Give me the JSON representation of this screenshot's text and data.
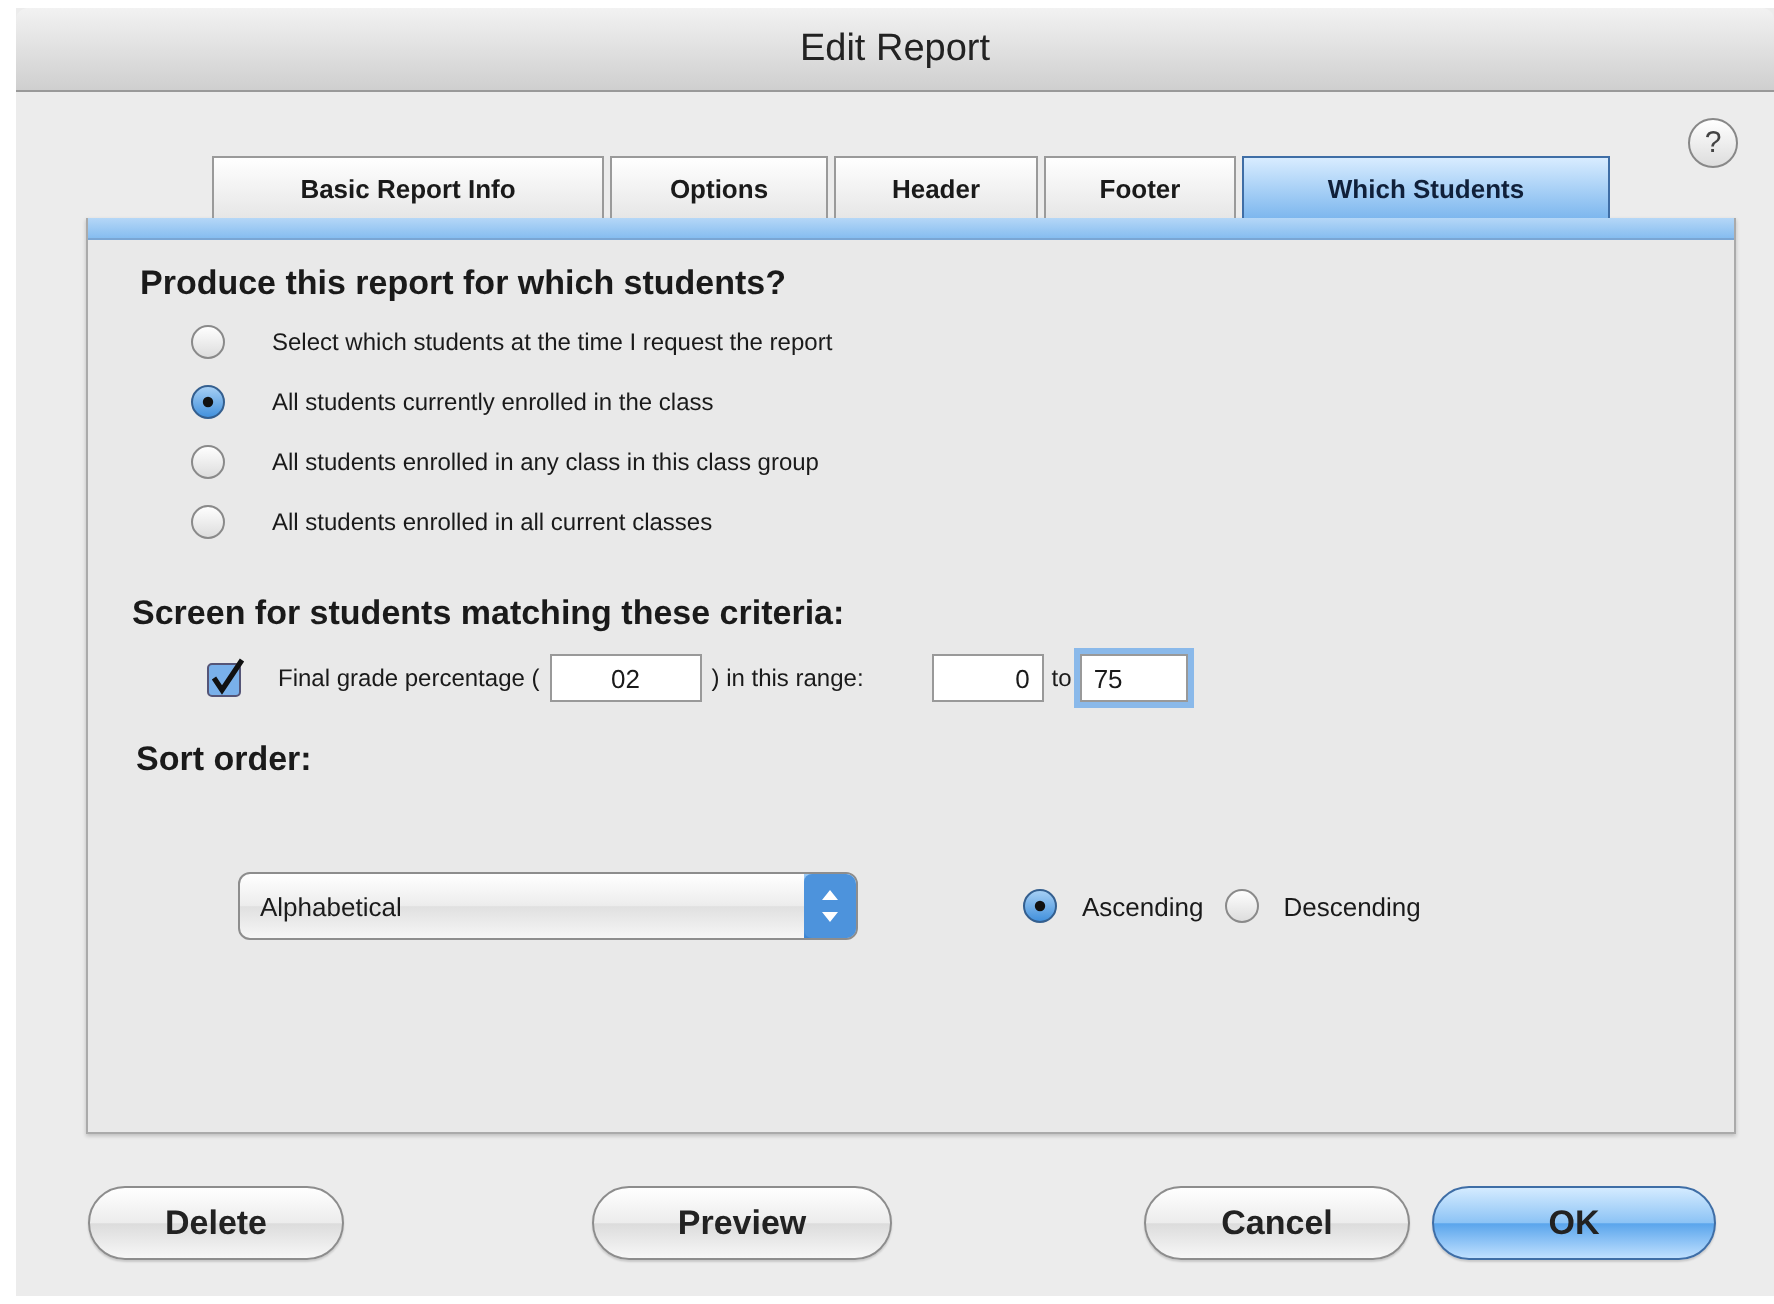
{
  "window": {
    "title": "Edit Report"
  },
  "help_button": {
    "label": "?"
  },
  "tabs": [
    {
      "label": "Basic Report Info",
      "selected": false
    },
    {
      "label": "Options",
      "selected": false
    },
    {
      "label": "Header",
      "selected": false
    },
    {
      "label": "Footer",
      "selected": false
    },
    {
      "label": "Which Students",
      "selected": true
    }
  ],
  "recipients": {
    "heading": "Produce this report for which students?",
    "options": [
      {
        "label": "Select which students at the time I request the report",
        "selected": false
      },
      {
        "label": "All students currently enrolled in the class",
        "selected": true
      },
      {
        "label": "All students enrolled in any class in this class group",
        "selected": false
      },
      {
        "label": "All students enrolled in all current classes",
        "selected": false
      }
    ]
  },
  "criteria": {
    "heading": "Screen for students matching these criteria:",
    "filter": {
      "checked": true,
      "label": "Final grade percentage (",
      "field": {
        "value": "02"
      },
      "range_label": ") in this range:",
      "min": {
        "value": "0"
      },
      "to": "to",
      "max": {
        "value": "75",
        "focused": true
      }
    }
  },
  "sort": {
    "heading": "Sort order:",
    "field": {
      "value": "Alphabetical"
    },
    "directions": [
      {
        "label": "Ascending",
        "selected": true
      },
      {
        "label": "Descending",
        "selected": false
      }
    ]
  },
  "buttons": [
    {
      "label": "Delete",
      "kind": "normal"
    },
    {
      "label": "Preview",
      "kind": "normal"
    },
    {
      "label": "Cancel",
      "kind": "normal"
    },
    {
      "label": "OK",
      "kind": "default"
    }
  ]
}
